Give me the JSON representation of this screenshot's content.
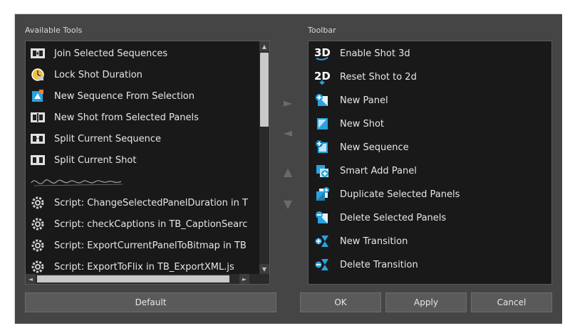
{
  "available_tools": {
    "caption": "Available Tools",
    "items": [
      {
        "label": "Join Selected Sequences",
        "icon": "join-sequences-icon"
      },
      {
        "label": "Lock Shot Duration",
        "icon": "lock-shot-duration-icon"
      },
      {
        "label": "New Sequence From Selection",
        "icon": "new-sequence-from-selection-icon"
      },
      {
        "label": "New Shot from Selected Panels",
        "icon": "new-shot-from-panels-icon"
      },
      {
        "label": "Split Current Sequence",
        "icon": "split-sequence-icon"
      },
      {
        "label": "Split Current Shot",
        "icon": "split-shot-icon"
      },
      {
        "label": "",
        "icon": "separator-squiggle-icon"
      },
      {
        "label": "Script: ChangeSelectedPanelDuration in T",
        "icon": "gear-icon"
      },
      {
        "label": "Script: checkCaptions in TB_CaptionSearc",
        "icon": "gear-icon"
      },
      {
        "label": "Script: ExportCurrentPanelToBitmap in TB",
        "icon": "gear-icon"
      },
      {
        "label": "Script: ExportToFlix in TB_ExportXML.js",
        "icon": "gear-icon"
      }
    ]
  },
  "toolbar": {
    "caption": "Toolbar",
    "items": [
      {
        "label": "Enable Shot 3d",
        "icon": "3d-icon"
      },
      {
        "label": "Reset Shot to 2d",
        "icon": "2d-icon"
      },
      {
        "label": "New Panel",
        "icon": "new-panel-icon"
      },
      {
        "label": "New Shot",
        "icon": "new-shot-icon"
      },
      {
        "label": "New Sequence",
        "icon": "new-sequence-icon"
      },
      {
        "label": "Smart Add Panel",
        "icon": "smart-add-panel-icon"
      },
      {
        "label": "Duplicate Selected Panels",
        "icon": "duplicate-panels-icon"
      },
      {
        "label": "Delete Selected Panels",
        "icon": "delete-panels-icon"
      },
      {
        "label": "New Transition",
        "icon": "new-transition-icon"
      },
      {
        "label": "Delete Transition",
        "icon": "delete-transition-icon"
      }
    ]
  },
  "transfer": {
    "add": "►",
    "remove": "◄",
    "up": "▲",
    "down": "▼"
  },
  "buttons": {
    "default": "Default",
    "ok": "OK",
    "apply": "Apply",
    "cancel": "Cancel"
  },
  "colors": {
    "dialog_bg": "#454545",
    "list_bg": "#191919",
    "accent_blue": "#29a3e0",
    "text": "#e6e6e6"
  }
}
